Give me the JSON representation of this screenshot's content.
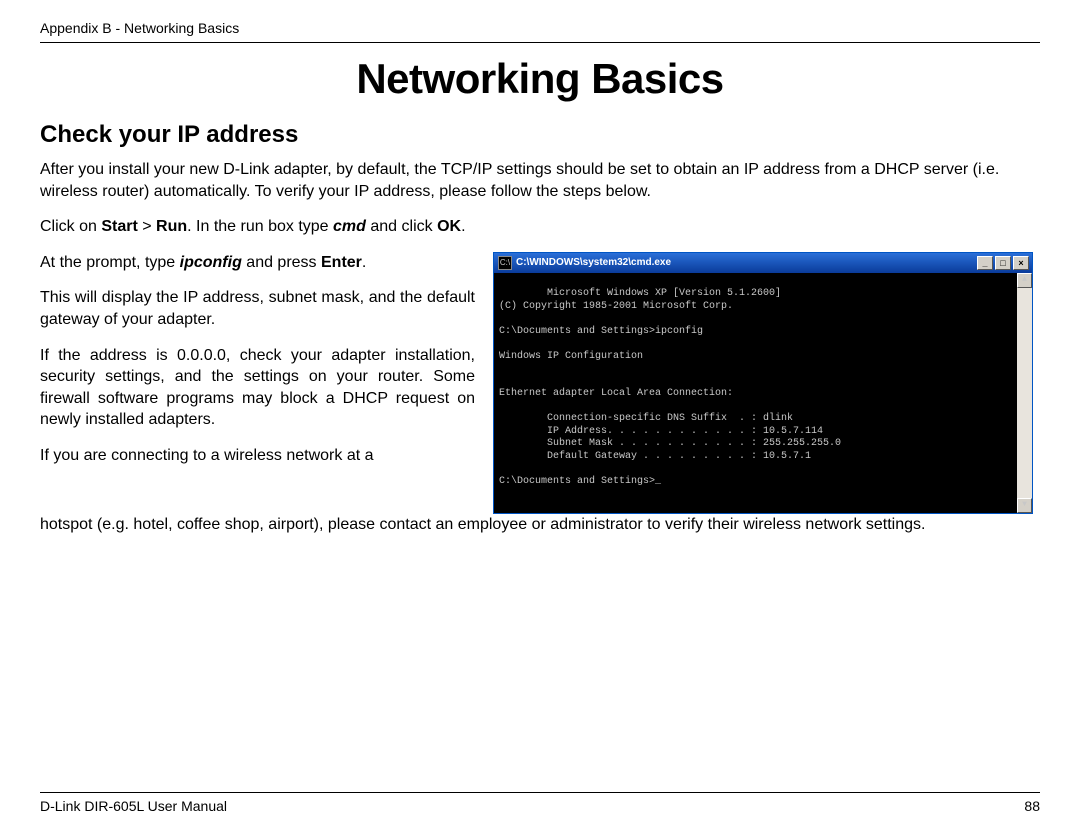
{
  "header": {
    "breadcrumb": "Appendix B - Networking Basics"
  },
  "title": "Networking Basics",
  "section": {
    "heading": "Check your IP address",
    "intro": "After you install your new D-Link adapter, by default, the TCP/IP settings should be set to obtain an IP address from a DHCP server (i.e. wireless router) automatically. To verify your IP address, please follow the steps below.",
    "step1_pre": "Click on ",
    "step1_start": "Start",
    "step1_gt": " > ",
    "step1_run": "Run",
    "step1_mid": ". In the run box type ",
    "step1_cmd": "cmd",
    "step1_post": " and click ",
    "step1_ok": "OK",
    "step1_end": ".",
    "step2_pre": "At the prompt, type ",
    "step2_ipc": "ipconfig",
    "step2_mid": " and press ",
    "step2_enter": "Enter",
    "step2_end": ".",
    "para3": "This will display the IP address, subnet mask, and the default gateway of your adapter.",
    "para4": "If the address is 0.0.0.0, check your adapter installation, security settings, and the settings on your router. Some firewall software programs may block a DHCP request on newly installed adapters.",
    "para5": "If you are connecting to a wireless network at a hotspot (e.g. hotel, coffee shop, airport), please contact an employee or administrator to verify their wireless network settings."
  },
  "cmd": {
    "title": "C:\\WINDOWS\\system32\\cmd.exe",
    "icon_glyph": "C:\\",
    "btn_min": "_",
    "btn_max": "□",
    "btn_close": "×",
    "scroll_up": "▲",
    "scroll_down": "▼",
    "output": "Microsoft Windows XP [Version 5.1.2600]\n(C) Copyright 1985-2001 Microsoft Corp.\n\nC:\\Documents and Settings>ipconfig\n\nWindows IP Configuration\n\n\nEthernet adapter Local Area Connection:\n\n        Connection-specific DNS Suffix  . : dlink\n        IP Address. . . . . . . . . . . . : 10.5.7.114\n        Subnet Mask . . . . . . . . . . . : 255.255.255.0\n        Default Gateway . . . . . . . . . : 10.5.7.1\n\nC:\\Documents and Settings>_"
  },
  "footer": {
    "left": "D-Link DIR-605L User Manual",
    "page": "88"
  }
}
